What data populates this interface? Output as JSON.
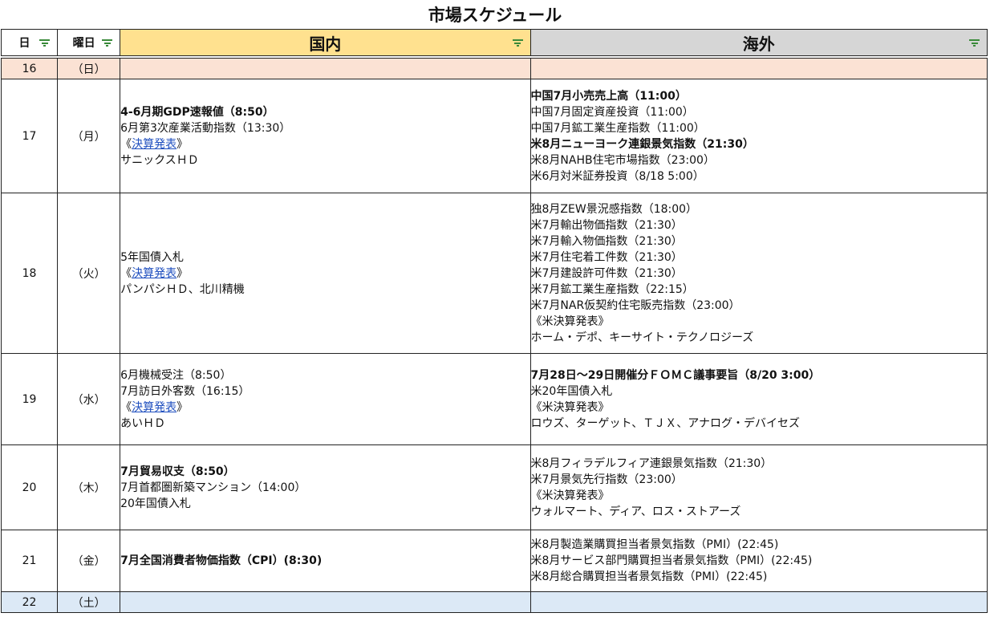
{
  "title": "市場スケジュール",
  "headers": {
    "day": "日",
    "weekday": "曜日",
    "domestic": "国内",
    "overseas": "海外"
  },
  "colors": {
    "domestic_header": "#ffe18f",
    "overseas_header": "#d6d6d6",
    "sunday_row": "#fbe2d4",
    "saturday_row": "#dce9f6",
    "link": "#1f4fbf",
    "filter_icon": "#3a8a3a"
  },
  "rows": [
    {
      "day": "16",
      "weekday": "（日）",
      "kind": "sun",
      "height": 26,
      "domestic": [],
      "overseas": []
    },
    {
      "day": "17",
      "weekday": "（月）",
      "kind": "normal",
      "height": 142,
      "domestic": [
        {
          "text": "4-6月期GDP速報値（8:50）",
          "bold": true
        },
        {
          "text": "6月第3次産業活動指数（13:30）"
        },
        {
          "pre": "《",
          "link": "決算発表",
          "post": "》"
        },
        {
          "text": "サニックスＨＤ"
        }
      ],
      "overseas": [
        {
          "text": "中国7月小売売上高（11:00）",
          "bold": true
        },
        {
          "text": "中国7月固定資産投資（11:00）"
        },
        {
          "text": "中国7月鉱工業生産指数（11:00）"
        },
        {
          "text": "米8月ニューヨーク連銀景気指数（21:30）",
          "bold": true
        },
        {
          "text": "米8月NAHB住宅市場指数（23:00）"
        },
        {
          "text": "米6月対米証券投資（8/18 5:00）"
        }
      ]
    },
    {
      "day": "18",
      "weekday": "（火）",
      "kind": "normal",
      "height": 200,
      "domestic": [
        {
          "text": "5年国債入札"
        },
        {
          "pre": "《",
          "link": "決算発表",
          "post": "》"
        },
        {
          "text": "パンパシＨＤ、北川精機"
        }
      ],
      "overseas": [
        {
          "text": "独8月ZEW景況感指数（18:00）"
        },
        {
          "text": "米7月輸出物価指数（21:30）"
        },
        {
          "text": "米7月輸入物価指数（21:30）"
        },
        {
          "text": "米7月住宅着工件数（21:30）"
        },
        {
          "text": "米7月建設許可件数（21:30）"
        },
        {
          "text": "米7月鉱工業生産指数（22:15）"
        },
        {
          "text": "米7月NAR仮契約住宅販売指数（23:00）"
        },
        {
          "text": "《米決算発表》"
        },
        {
          "text": "ホーム・デポ、キーサイト・テクノロジーズ"
        }
      ]
    },
    {
      "day": "19",
      "weekday": "（水）",
      "kind": "normal",
      "height": 114,
      "domestic": [
        {
          "text": "6月機械受注（8:50）"
        },
        {
          "text": "7月訪日外客数（16:15）"
        },
        {
          "pre": "《",
          "link": "決算発表",
          "post": "》"
        },
        {
          "text": "あいＨＤ"
        }
      ],
      "overseas": [
        {
          "text": "7月28日～29日開催分ＦＯＭＣ議事要旨（8/20 3:00）",
          "bold": true
        },
        {
          "text": "米20年国債入札"
        },
        {
          "text": "《米決算発表》"
        },
        {
          "text": "ロウズ、ターゲット、ＴＪＸ、アナログ・デバイセズ"
        }
      ]
    },
    {
      "day": "20",
      "weekday": "（木）",
      "kind": "normal",
      "height": 106,
      "domestic": [
        {
          "text": "7月貿易収支（8:50）",
          "bold": true
        },
        {
          "text": "7月首都圏新築マンション（14:00）"
        },
        {
          "text": "20年国債入札"
        }
      ],
      "overseas": [
        {
          "text": "米8月フィラデルフィア連銀景気指数（21:30）"
        },
        {
          "text": "米7月景気先行指数（23:00）"
        },
        {
          "text": "《米決算発表》"
        },
        {
          "text": "ウォルマート、ディア、ロス・ストアーズ"
        }
      ]
    },
    {
      "day": "21",
      "weekday": "（金）",
      "kind": "normal",
      "height": 77,
      "domestic": [
        {
          "text": "7月全国消費者物価指数（CPI）(8:30)",
          "bold": true
        }
      ],
      "overseas": [
        {
          "text": "米8月製造業購買担当者景気指数（PMI）(22:45)"
        },
        {
          "text": "米8月サービス部門購買担当者景気指数（PMI）(22:45)"
        },
        {
          "text": "米8月総合購買担当者景気指数（PMI）(22:45)"
        }
      ]
    },
    {
      "day": "22",
      "weekday": "（土）",
      "kind": "sat",
      "height": 26,
      "domestic": [],
      "overseas": []
    }
  ]
}
